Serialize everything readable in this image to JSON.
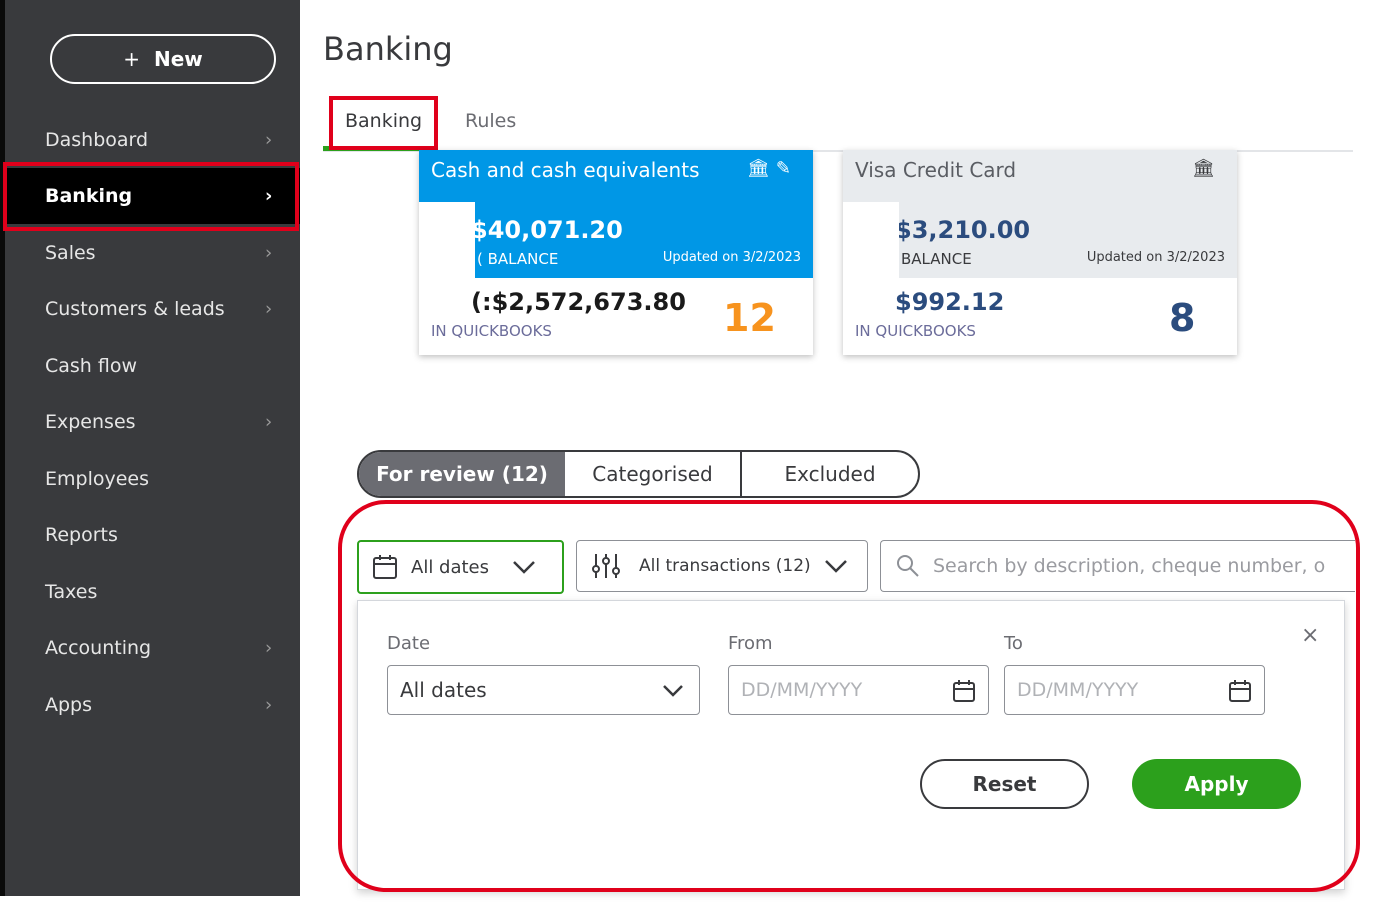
{
  "sidebar": {
    "new_label": "New",
    "items": [
      {
        "label": "Dashboard",
        "chevron": true
      },
      {
        "label": "Banking",
        "chevron": true,
        "active": true
      },
      {
        "label": "Sales",
        "chevron": true
      },
      {
        "label": "Customers & leads",
        "chevron": true
      },
      {
        "label": "Cash flow",
        "chevron": false
      },
      {
        "label": "Expenses",
        "chevron": true
      },
      {
        "label": "Employees",
        "chevron": false
      },
      {
        "label": "Reports",
        "chevron": false
      },
      {
        "label": "Taxes",
        "chevron": false
      },
      {
        "label": "Accounting",
        "chevron": true
      },
      {
        "label": "Apps",
        "chevron": true
      }
    ]
  },
  "page": {
    "title": "Banking",
    "tabs": [
      "Banking",
      "Rules"
    ]
  },
  "accounts": [
    {
      "name": "Cash and cash equivalents",
      "bank_balance": "$40,071.20",
      "bank_label": "( BALANCE",
      "updated": "Updated on 3/2/2023",
      "qb_balance": "(:$2,572,673.80",
      "qb_label": "IN QUICKBOOKS",
      "count": "12",
      "icons": [
        "bank-icon",
        "pencil-icon"
      ],
      "color": "#0097e6"
    },
    {
      "name": "Visa Credit Card",
      "bank_balance": "$3,210.00",
      "bank_label": "BALANCE",
      "updated": "Updated on 3/2/2023",
      "qb_balance": "$992.12",
      "qb_label": "IN QUICKBOOKS",
      "count": "8",
      "icons": [
        "bank-icon"
      ],
      "color": "#e8ebee"
    }
  ],
  "review_tabs": [
    "For review (12)",
    "Categorised",
    "Excluded"
  ],
  "filters": {
    "date_label": "All dates",
    "transactions_label": "All transactions (12)",
    "search_placeholder": "Search by description, cheque number, o"
  },
  "date_panel": {
    "date_label": "Date",
    "date_value": "All dates",
    "from_label": "From",
    "to_label": "To",
    "date_placeholder": "DD/MM/YYYY",
    "reset_label": "Reset",
    "apply_label": "Apply",
    "close_symbol": "×"
  },
  "colors": {
    "accent_green": "#2ca01c",
    "highlight_red": "#e0001b",
    "sidebar_bg": "#393a3d",
    "card_blue": "#0097e6",
    "count_orange": "#f7931e"
  }
}
